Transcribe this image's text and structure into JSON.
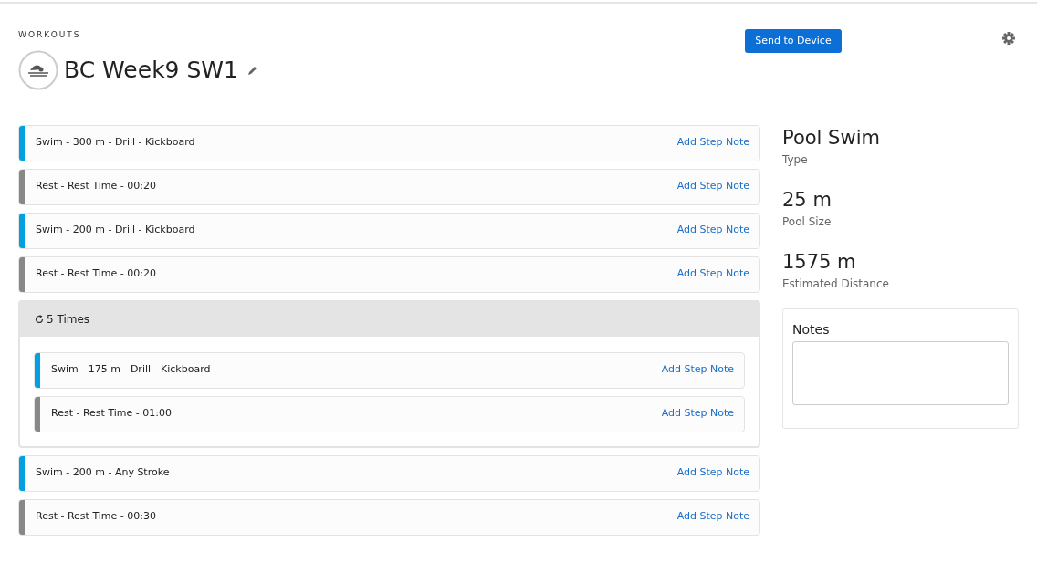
{
  "breadcrumb": "WORKOUTS",
  "title": "BC Week9 SW1",
  "send_button": "Send to Device",
  "steps": [
    {
      "kind": "step",
      "label": "Swim - 300 m - Drill - Kickboard",
      "color": "#00a0e1",
      "note_link": "Add Step Note"
    },
    {
      "kind": "step",
      "label": "Rest - Rest Time - 00:20",
      "color": "#888888",
      "note_link": "Add Step Note"
    },
    {
      "kind": "step",
      "label": "Swim - 200 m - Drill - Kickboard",
      "color": "#00a0e1",
      "note_link": "Add Step Note"
    },
    {
      "kind": "step",
      "label": "Rest - Rest Time - 00:20",
      "color": "#888888",
      "note_link": "Add Step Note"
    },
    {
      "kind": "repeat",
      "label": "5 Times",
      "children": [
        {
          "kind": "step",
          "label": "Swim - 175 m - Drill - Kickboard",
          "color": "#00a0e1",
          "note_link": "Add Step Note"
        },
        {
          "kind": "step",
          "label": "Rest - Rest Time - 01:00",
          "color": "#888888",
          "note_link": "Add Step Note"
        }
      ]
    },
    {
      "kind": "step",
      "label": "Swim - 200 m - Any Stroke",
      "color": "#00a0e1",
      "note_link": "Add Step Note"
    },
    {
      "kind": "step",
      "label": "Rest - Rest Time - 00:30",
      "color": "#888888",
      "note_link": "Add Step Note"
    }
  ],
  "summary": [
    {
      "value": "Pool Swim",
      "label": "Type"
    },
    {
      "value": "25 m",
      "label": "Pool Size"
    },
    {
      "value": "1575 m",
      "label": "Estimated Distance"
    }
  ],
  "notes": {
    "label": "Notes"
  }
}
